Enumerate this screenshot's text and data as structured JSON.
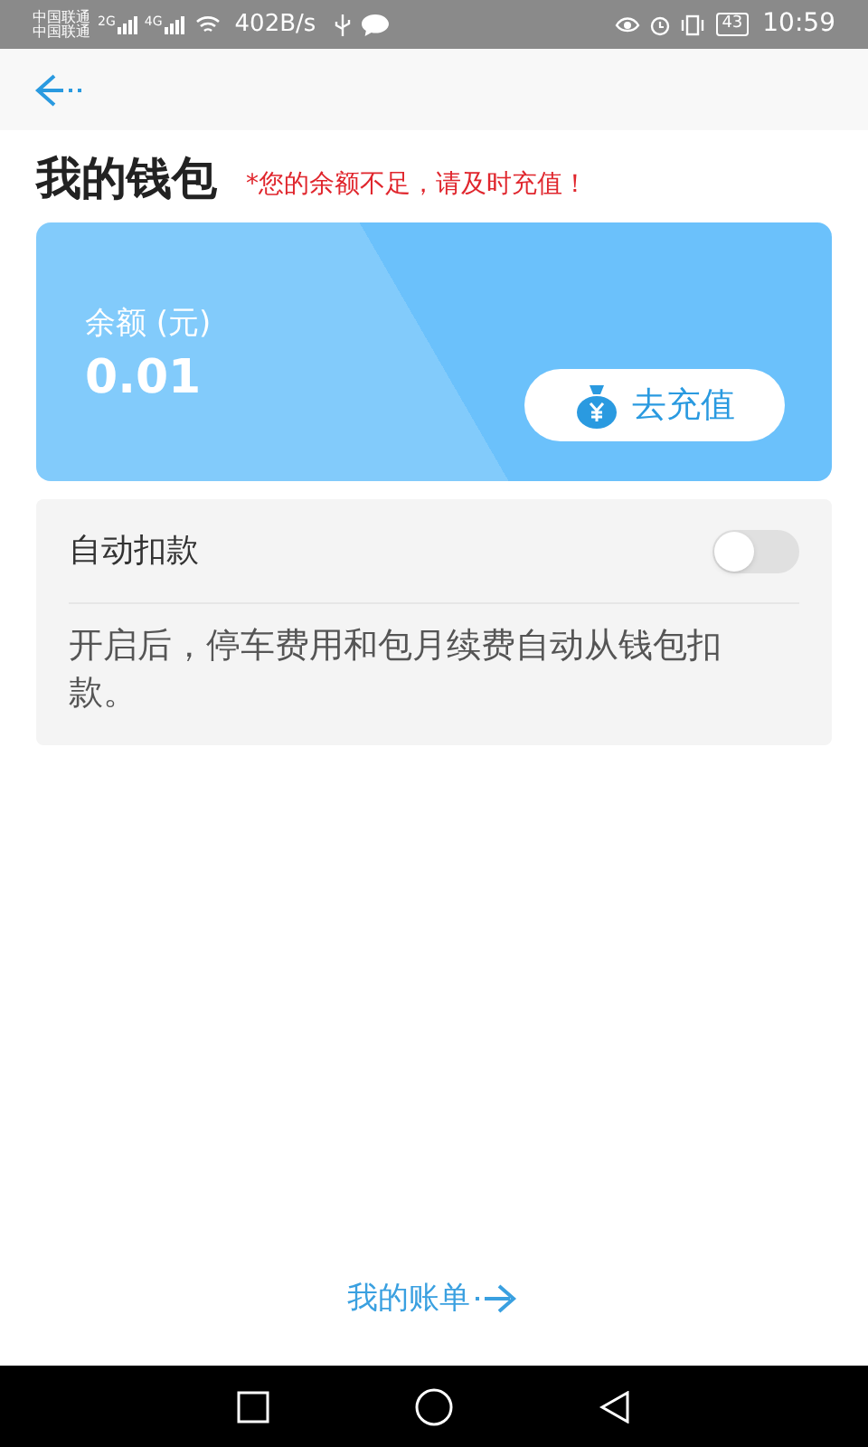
{
  "status_bar": {
    "carriers": [
      "中国联通",
      "中国联通"
    ],
    "networks": [
      "2G",
      "4G"
    ],
    "speed": "402B/s",
    "battery": "43",
    "time": "10:59"
  },
  "header": {
    "title": "我的钱包",
    "warning": "*您的余额不足，请及时充值！"
  },
  "balance_card": {
    "label": "余额 (元)",
    "amount": "0.01",
    "recharge_button": "去充值"
  },
  "auto_pay": {
    "label": "自动扣款",
    "on": false,
    "description": "开启后，停车费用和包月续费自动从钱包扣款。"
  },
  "bill_link": "我的账单"
}
